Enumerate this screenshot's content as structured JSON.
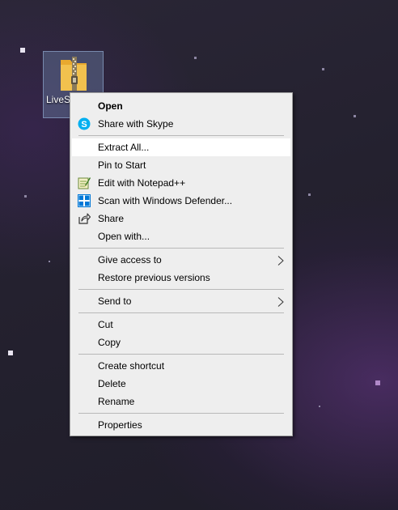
{
  "desktop": {
    "icon": {
      "label": "LiveS",
      "icon_name": "zip-folder-icon"
    }
  },
  "context_menu": {
    "items": [
      {
        "label": "Open",
        "bold": true
      },
      {
        "label": "Share with Skype",
        "icon": "skype-icon"
      },
      {
        "label": "Extract All...",
        "highlighted": true
      },
      {
        "label": "Pin to Start"
      },
      {
        "label": "Edit with Notepad++",
        "icon": "notepad-plus-plus-icon"
      },
      {
        "label": "Scan with Windows Defender...",
        "icon": "windows-defender-icon"
      },
      {
        "label": "Share",
        "icon": "share-icon"
      },
      {
        "label": "Open with..."
      },
      {
        "label": "Give access to",
        "submenu": true
      },
      {
        "label": "Restore previous versions"
      },
      {
        "label": "Send to",
        "submenu": true
      },
      {
        "label": "Cut"
      },
      {
        "label": "Copy"
      },
      {
        "label": "Create shortcut"
      },
      {
        "label": "Delete"
      },
      {
        "label": "Rename"
      },
      {
        "label": "Properties"
      }
    ]
  },
  "colors": {
    "menu_background": "#eeeeee",
    "menu_highlight": "#ffffff",
    "separator": "#b8b8b8",
    "skype_blue": "#00aff0",
    "defender_blue": "#0078d7",
    "folder_yellow": "#f2c14e"
  }
}
